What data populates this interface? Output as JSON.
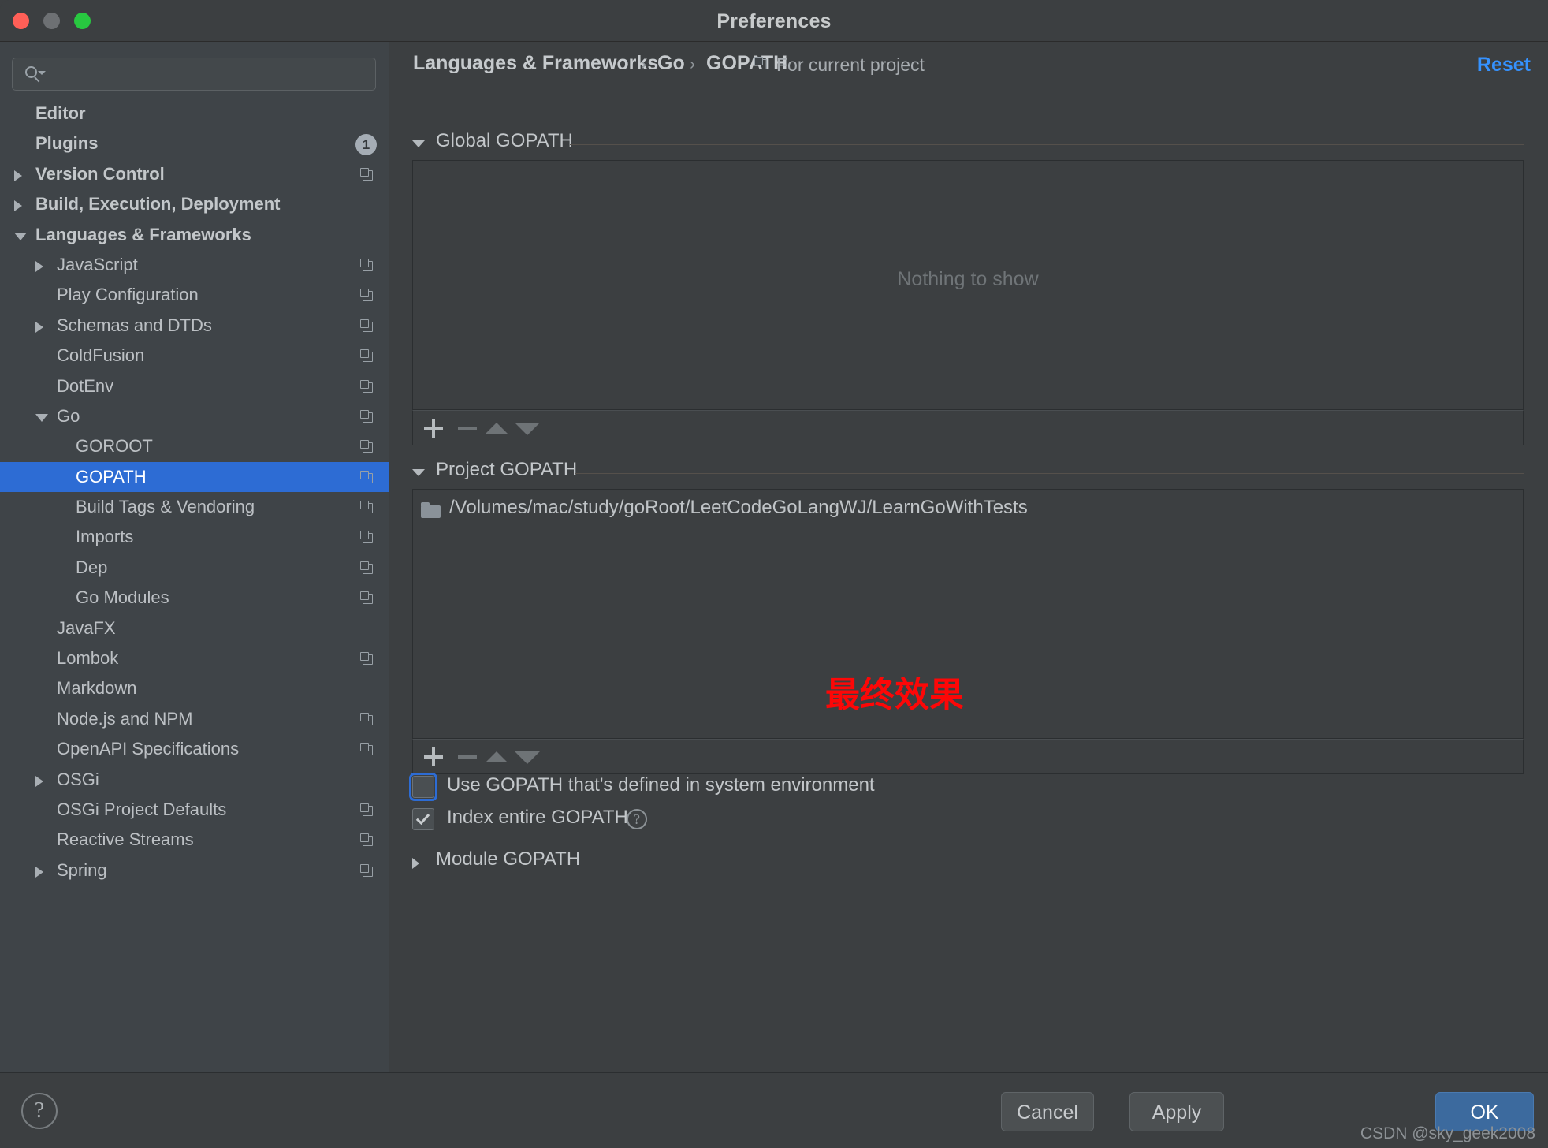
{
  "window": {
    "title": "Preferences",
    "traffic_lights": [
      "close",
      "minimize",
      "zoom"
    ]
  },
  "search": {
    "value": "",
    "placeholder": ""
  },
  "sidebar": {
    "items": [
      {
        "label": "Editor",
        "indent": 45,
        "bold": true,
        "arrow": "none",
        "copy": false,
        "badge": "",
        "selected": false
      },
      {
        "label": "Plugins",
        "indent": 45,
        "bold": true,
        "arrow": "none",
        "copy": false,
        "badge": "1",
        "selected": false
      },
      {
        "label": "Version Control",
        "indent": 45,
        "bold": true,
        "arrow": "collapsed",
        "copy": true,
        "badge": "",
        "selected": false
      },
      {
        "label": "Build, Execution, Deployment",
        "indent": 45,
        "bold": true,
        "arrow": "collapsed",
        "copy": false,
        "badge": "",
        "selected": false
      },
      {
        "label": "Languages & Frameworks",
        "indent": 45,
        "bold": true,
        "arrow": "expanded",
        "copy": false,
        "badge": "",
        "selected": false
      },
      {
        "label": "JavaScript",
        "indent": 72,
        "bold": false,
        "arrow": "collapsed",
        "copy": true,
        "badge": "",
        "selected": false
      },
      {
        "label": "Play Configuration",
        "indent": 72,
        "bold": false,
        "arrow": "none",
        "copy": true,
        "badge": "",
        "selected": false
      },
      {
        "label": "Schemas and DTDs",
        "indent": 72,
        "bold": false,
        "arrow": "collapsed",
        "copy": true,
        "badge": "",
        "selected": false
      },
      {
        "label": "ColdFusion",
        "indent": 72,
        "bold": false,
        "arrow": "none",
        "copy": true,
        "badge": "",
        "selected": false
      },
      {
        "label": "DotEnv",
        "indent": 72,
        "bold": false,
        "arrow": "none",
        "copy": true,
        "badge": "",
        "selected": false
      },
      {
        "label": "Go",
        "indent": 72,
        "bold": false,
        "arrow": "expanded",
        "copy": true,
        "badge": "",
        "selected": false
      },
      {
        "label": "GOROOT",
        "indent": 96,
        "bold": false,
        "arrow": "none",
        "copy": true,
        "badge": "",
        "selected": false
      },
      {
        "label": "GOPATH",
        "indent": 96,
        "bold": false,
        "arrow": "none",
        "copy": true,
        "badge": "",
        "selected": true
      },
      {
        "label": "Build Tags & Vendoring",
        "indent": 96,
        "bold": false,
        "arrow": "none",
        "copy": true,
        "badge": "",
        "selected": false
      },
      {
        "label": "Imports",
        "indent": 96,
        "bold": false,
        "arrow": "none",
        "copy": true,
        "badge": "",
        "selected": false
      },
      {
        "label": "Dep",
        "indent": 96,
        "bold": false,
        "arrow": "none",
        "copy": true,
        "badge": "",
        "selected": false
      },
      {
        "label": "Go Modules",
        "indent": 96,
        "bold": false,
        "arrow": "none",
        "copy": true,
        "badge": "",
        "selected": false
      },
      {
        "label": "JavaFX",
        "indent": 72,
        "bold": false,
        "arrow": "none",
        "copy": false,
        "badge": "",
        "selected": false
      },
      {
        "label": "Lombok",
        "indent": 72,
        "bold": false,
        "arrow": "none",
        "copy": true,
        "badge": "",
        "selected": false
      },
      {
        "label": "Markdown",
        "indent": 72,
        "bold": false,
        "arrow": "none",
        "copy": false,
        "badge": "",
        "selected": false
      },
      {
        "label": "Node.js and NPM",
        "indent": 72,
        "bold": false,
        "arrow": "none",
        "copy": true,
        "badge": "",
        "selected": false
      },
      {
        "label": "OpenAPI Specifications",
        "indent": 72,
        "bold": false,
        "arrow": "none",
        "copy": true,
        "badge": "",
        "selected": false
      },
      {
        "label": "OSGi",
        "indent": 72,
        "bold": false,
        "arrow": "collapsed",
        "copy": false,
        "badge": "",
        "selected": false
      },
      {
        "label": "OSGi Project Defaults",
        "indent": 72,
        "bold": false,
        "arrow": "none",
        "copy": true,
        "badge": "",
        "selected": false
      },
      {
        "label": "Reactive Streams",
        "indent": 72,
        "bold": false,
        "arrow": "none",
        "copy": true,
        "badge": "",
        "selected": false
      },
      {
        "label": "Spring",
        "indent": 72,
        "bold": false,
        "arrow": "collapsed",
        "copy": true,
        "badge": "",
        "selected": false
      }
    ]
  },
  "breadcrumb": {
    "crumb1": "Languages & Frameworks",
    "sep1": "›",
    "crumb2": "Go",
    "sep2": "›",
    "crumb3": "GOPATH",
    "scope_label": "For current project",
    "reset_label": "Reset"
  },
  "global_gopath": {
    "title": "Global GOPATH",
    "expanded": true,
    "empty_text": "Nothing to show",
    "toolbar": {
      "add": "add",
      "remove": "remove",
      "move_up": "move-up",
      "move_down": "move-down"
    }
  },
  "project_gopath": {
    "title": "Project GOPATH",
    "expanded": true,
    "paths": [
      "/Volumes/mac/study/goRoot/LeetCodeGoLangWJ/LearnGoWithTests"
    ],
    "toolbar": {
      "add": "add",
      "remove": "remove",
      "move_up": "move-up",
      "move_down": "move-down"
    }
  },
  "annotation": {
    "text": "最终效果",
    "color": "#fd0707"
  },
  "options": {
    "use_system_gopath": {
      "label": "Use GOPATH that's defined in system environment",
      "checked": false,
      "focused": true
    },
    "index_entire_gopath": {
      "label": "Index entire GOPATH",
      "checked": true,
      "help": "?"
    }
  },
  "module_gopath": {
    "title": "Module GOPATH",
    "expanded": false
  },
  "footer": {
    "help": "?",
    "cancel_label": "Cancel",
    "apply_label": "Apply",
    "ok_label": "OK",
    "watermark": "CSDN @sky_geek2008"
  },
  "colors": {
    "accent_selection": "#2d6cd4",
    "link": "#3592ff",
    "primary_button": "#3c6a9e",
    "annotation": "#fd0707",
    "window_bg": "#3c3f41",
    "sidebar_bg": "#3f4448"
  }
}
